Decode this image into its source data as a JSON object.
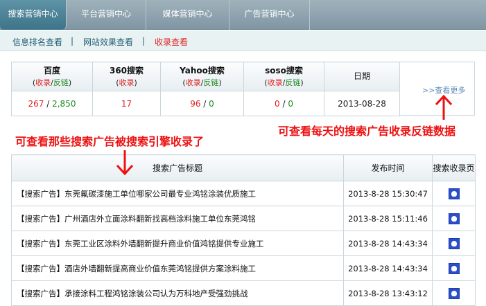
{
  "topnav": {
    "tabs": [
      {
        "label": "搜索营销中心"
      },
      {
        "label": "平台营销中心"
      },
      {
        "label": "媒体营销中心"
      },
      {
        "label": "广告营销中心"
      }
    ]
  },
  "subnav": {
    "items": [
      {
        "label": "信息排名查看"
      },
      {
        "label": "网站效果查看"
      },
      {
        "label": "收录查看"
      }
    ],
    "separator": "|"
  },
  "stats": {
    "columns": [
      {
        "name": "百度",
        "sub_a": "收录",
        "sub_slash": "/",
        "sub_b": "反链",
        "open": "(",
        "close": ")"
      },
      {
        "name": "360搜索",
        "sub_a": "收录",
        "open": "(",
        "close": ")"
      },
      {
        "name": "Yahoo搜索",
        "sub_a": "收录",
        "sub_slash": "/",
        "sub_b": "反链",
        "open": "(",
        "close": ")"
      },
      {
        "name": "soso搜索",
        "sub_a": "收录",
        "sub_slash": "/",
        "sub_b": "反链",
        "open": "(",
        "close": ")"
      },
      {
        "name": "日期"
      }
    ],
    "values": {
      "baidu_a": "267",
      "baidu_b": "2,850",
      "s360": "17",
      "yahoo_a": "96",
      "yahoo_b": "0",
      "soso_a": "0",
      "soso_b": "0",
      "date": "2013-08-28",
      "slash": " / "
    },
    "more_link": ">>查看更多"
  },
  "annotations": {
    "right": "可查看每天的搜索广告收录反链数据",
    "left": "可查看那些搜索广告被搜索引擎收录了"
  },
  "ad_table": {
    "headers": {
      "title": "搜索广告标题",
      "time": "发布时间",
      "page": "搜索收录页"
    },
    "rows": [
      {
        "title": "【搜索广告】东莞氟碳漆施工单位哪家公司最专业鸿铭涂装优质施工",
        "time": "2013-8-28 15:30:47"
      },
      {
        "title": "【搜索广告】广州酒店外立面涂料翻新找高档涂料施工单位东莞鸿铭",
        "time": "2013-8-28 15:11:46"
      },
      {
        "title": "【搜索广告】东莞工业区涂料外墙翻新提升商业价值鸿铭提供专业施工",
        "time": "2013-8-28 14:43:34"
      },
      {
        "title": "【搜索广告】酒店外墙翻新提高商业价值东莞鸿铭提供方案涂料施工",
        "time": "2013-8-28 14:43:34"
      },
      {
        "title": "【搜索广告】承接涂料工程鸿铭涂装公司认为万科地产受强劲挑战",
        "time": "2013-8-28 13:43:12"
      }
    ],
    "page_icon": "baidu-paw-icon"
  },
  "colors": {
    "accent_red": "#e02020",
    "green": "#1f8a1f",
    "link_blue": "#5a8ab4",
    "nav_teal": "#3d7489"
  }
}
